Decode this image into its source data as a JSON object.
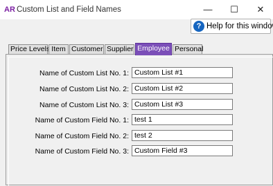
{
  "window": {
    "app_icon_text": "AR",
    "title": "Custom List and Field Names",
    "minimize_glyph": "—",
    "maximize_glyph": "☐",
    "close_glyph": "✕"
  },
  "help": {
    "icon_glyph": "?",
    "label": "Help for this window"
  },
  "tabs": [
    {
      "label": "Price Levels",
      "active": false
    },
    {
      "label": "Item",
      "active": false
    },
    {
      "label": "Customer",
      "active": false
    },
    {
      "label": "Supplier",
      "active": false
    },
    {
      "label": "Employee",
      "active": true
    },
    {
      "label": "Personal",
      "active": false
    }
  ],
  "fields": [
    {
      "label": "Name of Custom List No. 1:",
      "value": "Custom List #1"
    },
    {
      "label": "Name of Custom List No. 2:",
      "value": "Custom List #2"
    },
    {
      "label": "Name of Custom List No. 3:",
      "value": "Custom List #3"
    },
    {
      "label": "Name of Custom Field No. 1:",
      "value": "test 1"
    },
    {
      "label": "Name of Custom Field No. 2:",
      "value": "test 2"
    },
    {
      "label": "Name of Custom Field No. 3:",
      "value": "Custom Field #3"
    }
  ]
}
